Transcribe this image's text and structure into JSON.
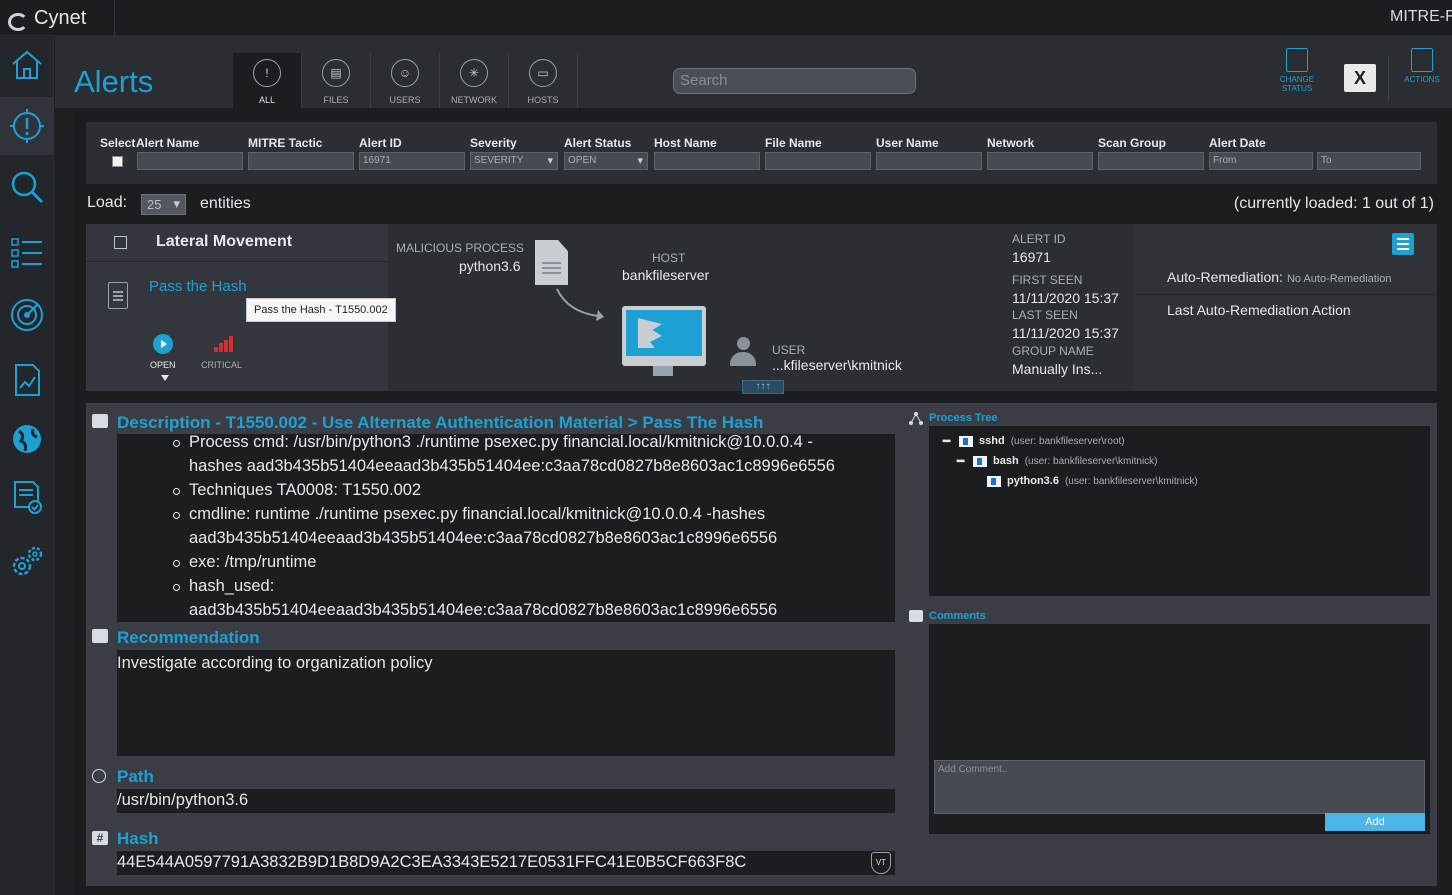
{
  "app": {
    "name": "Cynet",
    "top_right_link": "MITRE-F"
  },
  "header": {
    "title": "Alerts",
    "tabs": [
      {
        "label": "ALL",
        "icon": "alert-circle-icon"
      },
      {
        "label": "FILES",
        "icon": "file-target-icon"
      },
      {
        "label": "USERS",
        "icon": "users-icon"
      },
      {
        "label": "NETWORK",
        "icon": "network-icon"
      },
      {
        "label": "HOSTS",
        "icon": "host-icon"
      }
    ],
    "search_placeholder": "Search",
    "change_status_label": "CHANGE STATUS",
    "excel_label": "X",
    "actions_label": "ACTIONS"
  },
  "sidebar": {
    "items": [
      {
        "icon": "home-icon"
      },
      {
        "icon": "alert-icon"
      },
      {
        "icon": "search-icon"
      },
      {
        "icon": "list-icon"
      },
      {
        "icon": "radar-icon"
      },
      {
        "icon": "report-icon"
      },
      {
        "icon": "globe-icon"
      },
      {
        "icon": "checklist-icon"
      },
      {
        "icon": "settings-icon"
      }
    ]
  },
  "filters": {
    "select_label": "Select",
    "columns": {
      "alert_name": "Alert Name",
      "mitre_tactic": "MITRE Tactic",
      "alert_id": "Alert ID",
      "severity": "Severity",
      "alert_status": "Alert Status",
      "host_name": "Host Name",
      "file_name": "File Name",
      "user_name": "User Name",
      "network": "Network",
      "scan_group": "Scan Group",
      "alert_date": "Alert Date"
    },
    "values": {
      "alert_id": "16971",
      "severity": "SEVERITY",
      "alert_status": "OPEN",
      "date_from": "From",
      "date_to": "To"
    }
  },
  "load": {
    "label": "Load:",
    "value": "25",
    "suffix": "entities",
    "currently_loaded": "(currently loaded: 1 out of 1)"
  },
  "alert": {
    "type": "Lateral Movement",
    "name": "Pass the Hash",
    "tooltip": "Pass the Hash - T1550.002",
    "status": "OPEN",
    "severity": "CRITICAL",
    "malicious_process_label": "MALICIOUS PROCESS",
    "malicious_process": "python3.6",
    "host_label": "HOST",
    "host": "bankfileserver",
    "user_label": "USER",
    "user": "...kfileserver\\kmitnick",
    "alert_id_label": "ALERT ID",
    "alert_id": "16971",
    "first_seen_label": "FIRST SEEN",
    "first_seen": "11/11/2020 15:37",
    "last_seen_label": "LAST SEEN",
    "last_seen": "11/11/2020 15:37",
    "group_name_label": "GROUP NAME",
    "group_name": "Manually Ins...",
    "auto_remediation_label": "Auto-Remediation:",
    "auto_remediation_value": "No Auto-Remediation",
    "last_auto_remediation_label": "Last Auto-Remediation Action",
    "expand_arrows": "↑↑↑"
  },
  "details": {
    "description_title": "Description - T1550.002 - Use Alternate Authentication Material > Pass The Hash",
    "description_lines": [
      {
        "text": "Process cmd: /usr/bin/python3 ./runtime psexec.py financial.local/kmitnick@10.0.0.4 -",
        "bullet": true
      },
      {
        "text": "hashes aad3b435b51404eeaad3b435b51404ee:c3aa78cd0827b8e8603ac1c8996e6556",
        "bullet": false
      },
      {
        "text": " Techniques TA0008: T1550.002",
        "bullet": true
      },
      {
        "text": "cmdline: runtime ./runtime psexec.py financial.local/kmitnick@10.0.0.4 -hashes",
        "bullet": true
      },
      {
        "text": "aad3b435b51404eeaad3b435b51404ee:c3aa78cd0827b8e8603ac1c8996e6556",
        "bullet": false
      },
      {
        "text": "exe: /tmp/runtime",
        "bullet": true
      },
      {
        "text": "hash_used:",
        "bullet": true
      },
      {
        "text": "aad3b435b51404eeaad3b435b51404ee:c3aa78cd0827b8e8603ac1c8996e6556",
        "bullet": false
      }
    ],
    "recommendation_title": "Recommendation",
    "recommendation": "Investigate according to organization policy",
    "path_title": "Path",
    "path": "/usr/bin/python3.6",
    "hash_title": "Hash",
    "hash": "44E544A0597791A3832B9D1B8D9A2C3EA3343E5217E0531FFC41E0B5CF663F8C",
    "vt_label": "VT"
  },
  "process_tree": {
    "title": "Process Tree",
    "nodes": [
      {
        "name": "sshd",
        "user": "(user: bankfileserver\\root)"
      },
      {
        "name": "bash",
        "user": "(user: bankfileserver\\kmitnick)"
      },
      {
        "name": "python3.6",
        "user": "(user: bankfileserver\\kmitnick)"
      }
    ]
  },
  "comments": {
    "title": "Comments",
    "placeholder": "Add Comment..",
    "add_label": "Add"
  },
  "colors": {
    "accent": "#1da1d4",
    "critical": "#d62e2e"
  }
}
